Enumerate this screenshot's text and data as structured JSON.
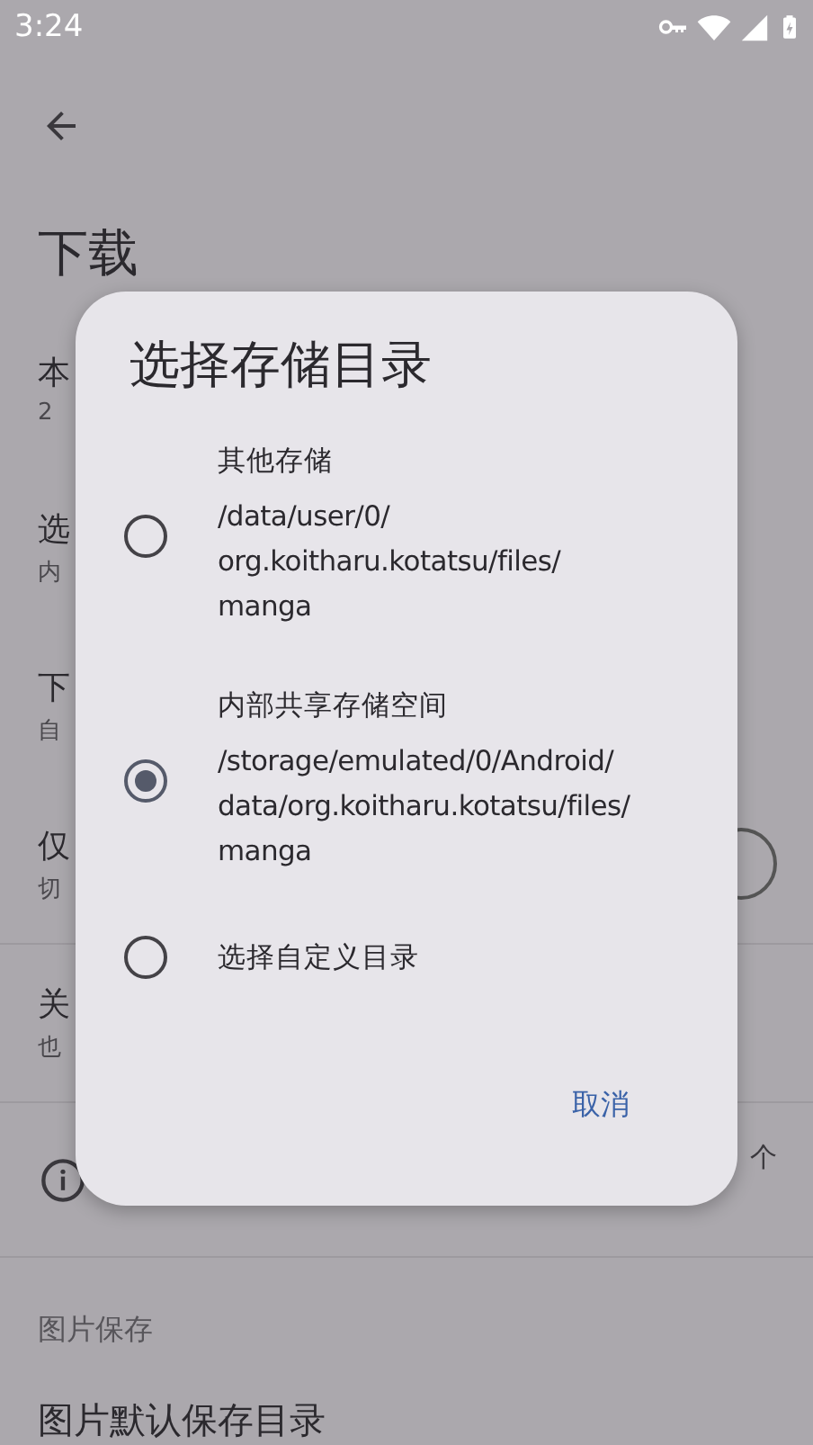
{
  "status_bar": {
    "time": "3:24"
  },
  "page_title": "下载",
  "settings": [
    {
      "kind": "text",
      "title": "本",
      "summary": "2"
    },
    {
      "kind": "text",
      "title": "选",
      "summary": "内"
    },
    {
      "kind": "text",
      "title": "下",
      "summary": "自"
    },
    {
      "kind": "switch",
      "title": "仅",
      "summary": "切"
    },
    {
      "kind": "text",
      "title": "关",
      "summary": "也"
    }
  ],
  "info": {
    "text": "个"
  },
  "section_header": "图片保存",
  "last_item": {
    "title": "图片默认保存目录"
  },
  "dialog": {
    "title": "选择存储目录",
    "options": [
      {
        "title": "其他存储",
        "path_lines": [
          "/data/user/0/",
          "org.koitharu.kotatsu/files/",
          "manga"
        ],
        "selected": false
      },
      {
        "title": "内部共享存储空间",
        "path_lines": [
          "/storage/emulated/0/Android/",
          "data/org.koitharu.kotatsu/files/",
          "manga"
        ],
        "selected": true
      },
      {
        "title": "选择自定义目录",
        "selected": false
      }
    ],
    "buttons": [
      "取消"
    ]
  }
}
